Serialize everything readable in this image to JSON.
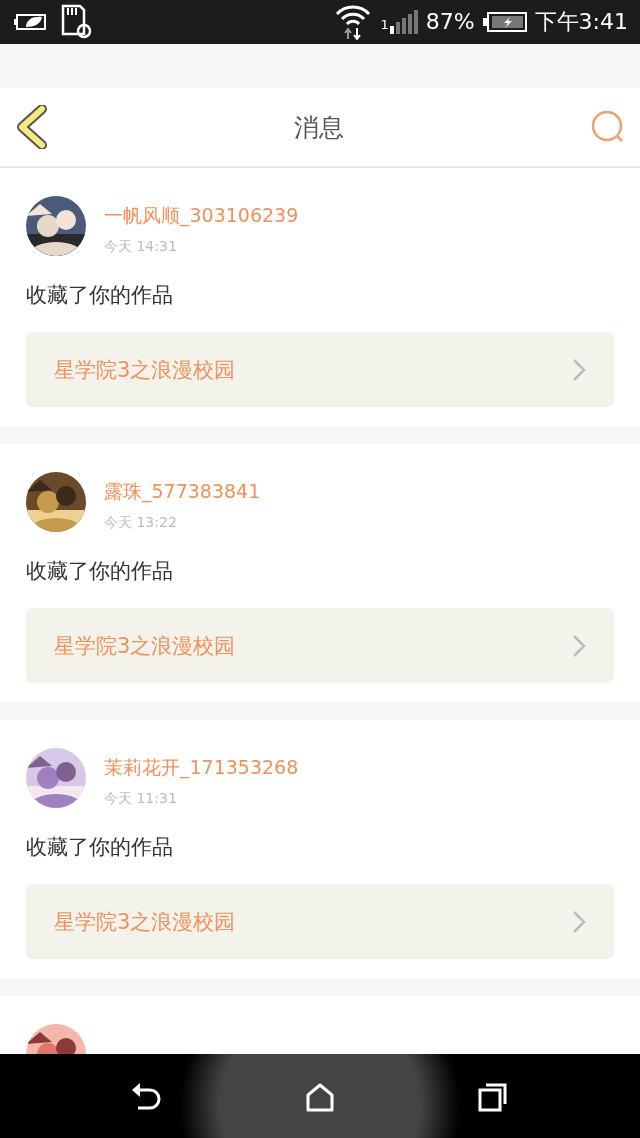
{
  "status_bar": {
    "sim_label": "1",
    "battery_percent": "87%",
    "time": "下午3:41"
  },
  "header": {
    "title": "消息"
  },
  "messages": [
    {
      "kind": "message",
      "name": "一帆风顺_303106239",
      "time": "今天 14:31",
      "action": "收藏了你的作品",
      "work": "星学院3之浪漫校园"
    },
    {
      "kind": "message",
      "name": "露珠_577383841",
      "time": "今天 13:22",
      "action": "收藏了你的作品",
      "work": "星学院3之浪漫校园"
    },
    {
      "kind": "message",
      "name": "茉莉花开_171353268",
      "time": "今天 11:31",
      "action": "收藏了你的作品",
      "work": "星学院3之浪漫校园"
    },
    {
      "kind": "clipped"
    }
  ]
}
